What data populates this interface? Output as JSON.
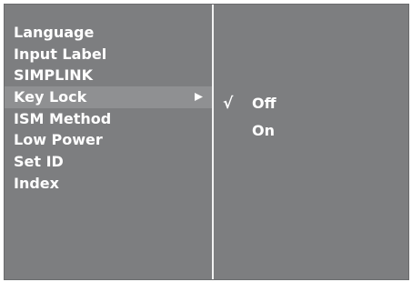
{
  "menu": {
    "items": [
      {
        "label": "Language"
      },
      {
        "label": "Input Label"
      },
      {
        "label": "SIMPLINK"
      },
      {
        "label": "Key Lock"
      },
      {
        "label": "ISM Method"
      },
      {
        "label": "Low Power"
      },
      {
        "label": "Set ID"
      },
      {
        "label": "Index"
      }
    ],
    "selected_index": 3,
    "arrow_icon": "right-triangle-icon"
  },
  "submenu": {
    "check_glyph": "√",
    "options": [
      {
        "label": "Off",
        "checked": true
      },
      {
        "label": "On",
        "checked": false
      }
    ]
  },
  "colors": {
    "panel_background": "#7d7e80",
    "selected_highlight": "#8f9092",
    "text": "#ffffff",
    "divider": "#f2f2f2"
  }
}
